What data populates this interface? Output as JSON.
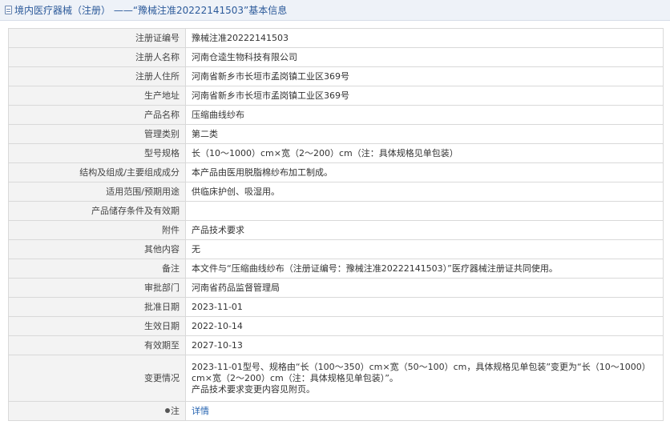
{
  "header": {
    "title": "境内医疗器械（注册） ——“豫械注准20222141503”基本信息"
  },
  "rows": [
    {
      "label": "注册证编号",
      "value": "豫械注准20222141503"
    },
    {
      "label": "注册人名称",
      "value": "河南仓逵生物科技有限公司"
    },
    {
      "label": "注册人住所",
      "value": "河南省新乡市长垣市孟岗镇工业区369号"
    },
    {
      "label": "生产地址",
      "value": "河南省新乡市长垣市孟岗镇工业区369号"
    },
    {
      "label": "产品名称",
      "value": "压缩曲线纱布"
    },
    {
      "label": "管理类别",
      "value": "第二类"
    },
    {
      "label": "型号规格",
      "value": "长（10～1000）cm×宽（2～200）cm（注：具体规格见单包装）"
    },
    {
      "label": "结构及组成/主要组成成分",
      "value": "本产品由医用脱脂棉纱布加工制成。"
    },
    {
      "label": "适用范围/预期用途",
      "value": "供临床护创、吸湿用。"
    },
    {
      "label": "产品储存条件及有效期",
      "value": ""
    },
    {
      "label": "附件",
      "value": "产品技术要求"
    },
    {
      "label": "其他内容",
      "value": "无"
    },
    {
      "label": "备注",
      "value": "本文件与“压缩曲线纱布（注册证编号：豫械注准20222141503）”医疗器械注册证共同使用。"
    },
    {
      "label": "审批部门",
      "value": "河南省药品监督管理局"
    },
    {
      "label": "批准日期",
      "value": "2023-11-01"
    },
    {
      "label": "生效日期",
      "value": "2022-10-14"
    },
    {
      "label": "有效期至",
      "value": "2027-10-13"
    }
  ],
  "change_row": {
    "label": "变更情况",
    "line1": "2023-11-01型号、规格由“长（100～350）cm×宽（50～100）cm，具体规格见单包装”变更为“长（10～1000）cm×宽（2～200）cm（注：具体规格见单包装）”。",
    "line2": "产品技术要求变更内容见附页。"
  },
  "note_row": {
    "label": "注",
    "link": "详情"
  },
  "colors": {
    "header_bg": "#eef2f8",
    "header_text": "#2c5a9a",
    "label_bg": "#f3f3f3",
    "border": "#d9d9d9",
    "link": "#2463b0"
  }
}
